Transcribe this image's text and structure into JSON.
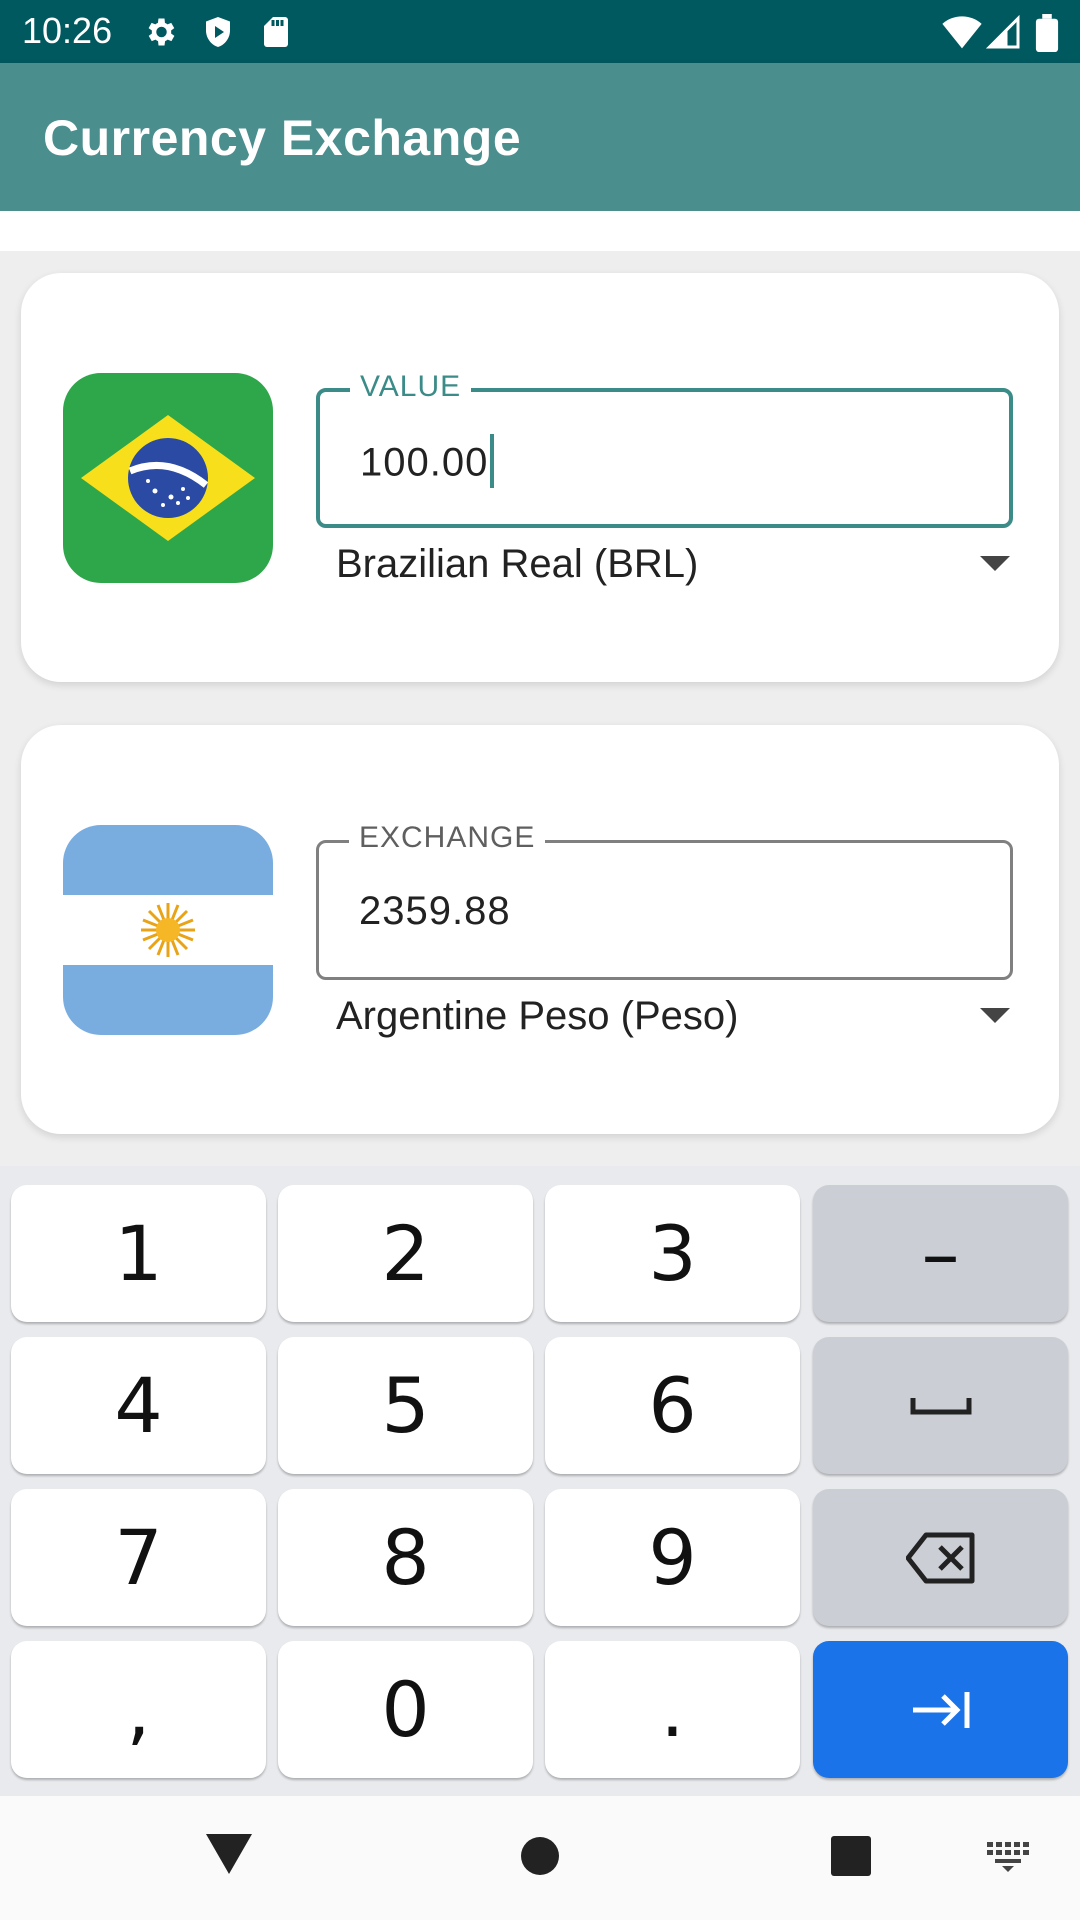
{
  "status_bar": {
    "time": "10:26",
    "icons": [
      "gear-icon",
      "shield-play-icon",
      "sd-card-icon",
      "wifi-icon",
      "cell-signal-icon",
      "battery-icon"
    ]
  },
  "app_bar": {
    "title": "Currency Exchange"
  },
  "source": {
    "flag": "brazil-flag",
    "field_label": "VALUE",
    "value": "100.00",
    "currency": "Brazilian Real (BRL)"
  },
  "target": {
    "flag": "argentina-flag",
    "field_label": "EXCHANGE",
    "value": "2359.88",
    "currency": "Argentine Peso (Peso)"
  },
  "keyboard": {
    "keys": [
      "1",
      "2",
      "3",
      "–",
      "4",
      "5",
      "6",
      "␣",
      "7",
      "8",
      "9",
      "⌫",
      ",",
      "0",
      ".",
      "⇥"
    ],
    "key_names": [
      "key-1",
      "key-2",
      "key-3",
      "key-minus",
      "key-4",
      "key-5",
      "key-6",
      "key-space",
      "key-7",
      "key-8",
      "key-9",
      "key-backspace",
      "key-comma",
      "key-0",
      "key-period",
      "key-next"
    ]
  },
  "nav": {
    "icons": [
      "back-icon",
      "home-icon",
      "recents-icon",
      "keyboard-switch-icon"
    ]
  },
  "colors": {
    "status_bar": "#00595f",
    "app_bar": "#4a8e8d",
    "accent": "#3b8b88",
    "action_key": "#1a73e8"
  }
}
